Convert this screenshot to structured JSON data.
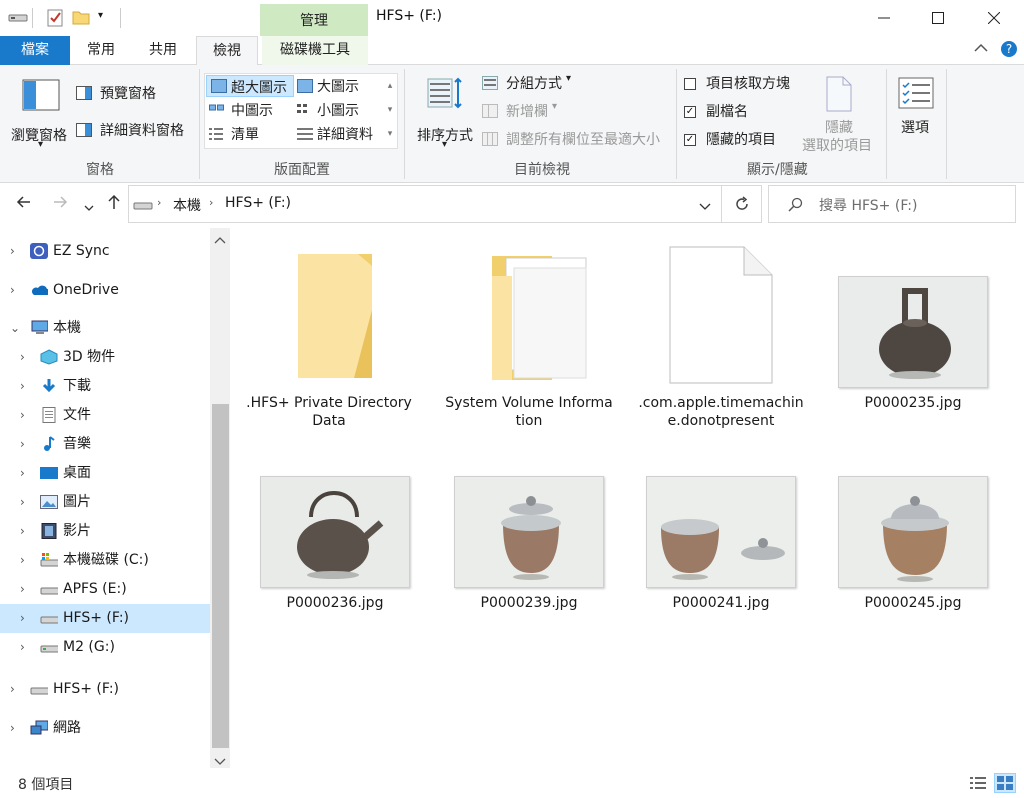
{
  "window": {
    "title": "HFS+ (F:)",
    "context_tab": "管理"
  },
  "ribbon_tabs": [
    "檔案",
    "常用",
    "共用",
    "檢視",
    "磁碟機工具"
  ],
  "ribbon": {
    "panes": {
      "nav_pane": "瀏覽窗格",
      "preview": "預覽窗格",
      "details": "詳細資料窗格",
      "group": "窗格"
    },
    "layout": {
      "xl_icons": "超大圖示",
      "l_icons": "大圖示",
      "m_icons": "中圖示",
      "s_icons": "小圖示",
      "list": "清單",
      "details": "詳細資料",
      "group": "版面配置"
    },
    "current_view": {
      "sort": "排序方式",
      "group_by": "分組方式",
      "add_cols": "新增欄",
      "fit_cols": "調整所有欄位至最適大小",
      "group": "目前檢視"
    },
    "show_hide": {
      "checkboxes": "項目核取方塊",
      "extensions": "副檔名",
      "hidden": "隱藏的項目",
      "hide_selected_1": "隱藏",
      "hide_selected_2": "選取的項目",
      "group": "顯示/隱藏"
    },
    "options": "選項"
  },
  "address": {
    "crumbs": [
      "本機",
      "HFS+ (F:)"
    ],
    "search_placeholder": "搜尋 HFS+ (F:)"
  },
  "nav": [
    {
      "label": "EZ Sync",
      "icon": "ez-sync-icon"
    },
    {
      "label": "OneDrive",
      "icon": "onedrive-icon"
    },
    {
      "label": "本機",
      "icon": "computer-icon"
    },
    {
      "label": "3D 物件",
      "icon": "3d-objects-icon"
    },
    {
      "label": "下載",
      "icon": "downloads-icon"
    },
    {
      "label": "文件",
      "icon": "documents-icon"
    },
    {
      "label": "音樂",
      "icon": "music-icon"
    },
    {
      "label": "桌面",
      "icon": "desktop-icon"
    },
    {
      "label": "圖片",
      "icon": "pictures-icon"
    },
    {
      "label": "影片",
      "icon": "videos-icon"
    },
    {
      "label": "本機磁碟 (C:)",
      "icon": "system-drive-icon"
    },
    {
      "label": "APFS (E:)",
      "icon": "drive-icon"
    },
    {
      "label": "HFS+ (F:)",
      "icon": "drive-icon"
    },
    {
      "label": "M2 (G:)",
      "icon": "drive-icon"
    },
    {
      "label": "HFS+ (F:)",
      "icon": "drive-icon"
    },
    {
      "label": "網路",
      "icon": "network-icon"
    }
  ],
  "items": [
    {
      "name": ".HFS+ Private Directory Data",
      "kind": "folder"
    },
    {
      "name": "System Volume Information",
      "kind": "folder-with-files"
    },
    {
      "name": ".com.apple.timemachine.donotpresent",
      "kind": "file"
    },
    {
      "name": "P0000235.jpg",
      "kind": "image"
    },
    {
      "name": "P0000236.jpg",
      "kind": "image"
    },
    {
      "name": "P0000239.jpg",
      "kind": "image"
    },
    {
      "name": "P0000241.jpg",
      "kind": "image"
    },
    {
      "name": "P0000245.jpg",
      "kind": "image"
    }
  ],
  "status": {
    "count": "8 個項目"
  },
  "colors": {
    "accent": "#1979ca",
    "selection": "#cce8ff",
    "context_tab": "#cfeac3",
    "folder": "#f8d775"
  }
}
